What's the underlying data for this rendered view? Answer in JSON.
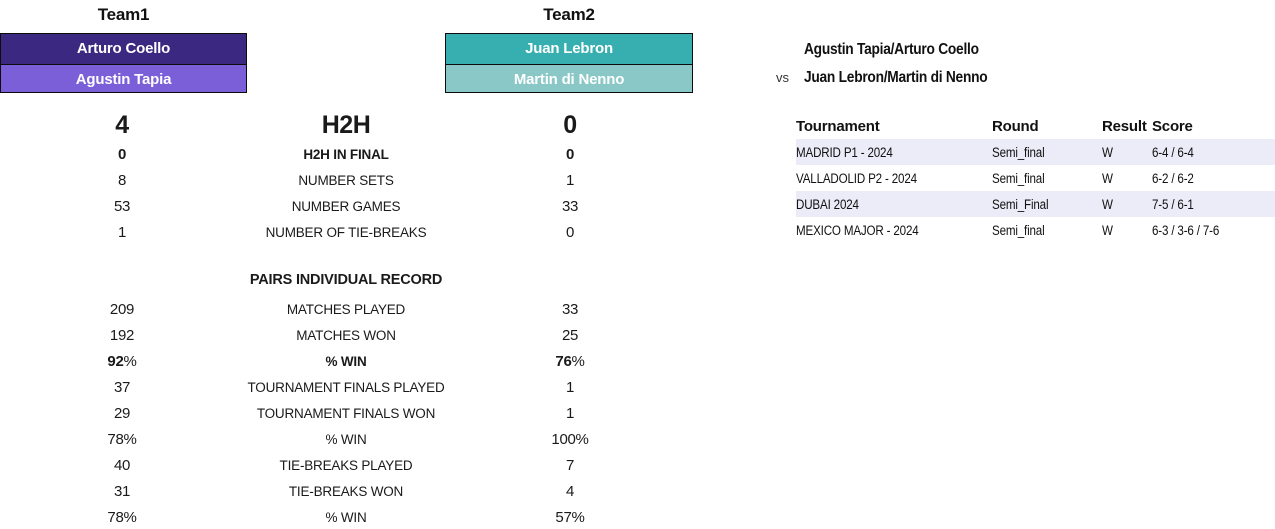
{
  "teams": {
    "team1": {
      "header": "Team1",
      "players": [
        "Arturo Coello",
        "Agustin Tapia"
      ],
      "color_top": "#3b2880",
      "color_bottom": "#7b5fd8"
    },
    "team2": {
      "header": "Team2",
      "players": [
        "Juan Lebron",
        "Martin di Nenno"
      ],
      "color_top": "#37afb0",
      "color_bottom": "#8ac7c7"
    }
  },
  "h2h": {
    "title": "H2H",
    "team1_total": "4",
    "team2_total": "0",
    "rows": [
      {
        "label": "H2H IN FINAL",
        "left": "0",
        "right": "0",
        "bold": true
      },
      {
        "label": "NUMBER SETS",
        "left": "8",
        "right": "1",
        "bold": false
      },
      {
        "label": "NUMBER GAMES",
        "left": "53",
        "right": "33",
        "bold": false
      },
      {
        "label": "NUMBER OF TIE-BREAKS",
        "left": "1",
        "right": "0",
        "bold": false
      }
    ]
  },
  "pairs_record": {
    "title": "PAIRS INDIVIDUAL RECORD",
    "rows": [
      {
        "label": "MATCHES PLAYED",
        "left": "209",
        "right": "33",
        "bold": false,
        "percent": false
      },
      {
        "label": "MATCHES WON",
        "left": "192",
        "right": "25",
        "bold": false,
        "percent": false
      },
      {
        "label": "% WIN",
        "left": "92",
        "right": "76",
        "bold": true,
        "percent": true
      },
      {
        "label": "TOURNAMENT FINALS PLAYED",
        "left": "37",
        "right": "1",
        "bold": false,
        "percent": false
      },
      {
        "label": "TOURNAMENT FINALS WON",
        "left": "29",
        "right": "1",
        "bold": false,
        "percent": false
      },
      {
        "label": "% WIN",
        "left": "78",
        "right": "100",
        "bold": false,
        "percent": true
      },
      {
        "label": "TIE-BREAKS PLAYED",
        "left": "40",
        "right": "7",
        "bold": false,
        "percent": false
      },
      {
        "label": "TIE-BREAKS WON",
        "left": "31",
        "right": "4",
        "bold": false,
        "percent": false
      },
      {
        "label": "% WIN",
        "left": "78",
        "right": "57",
        "bold": false,
        "percent": true
      }
    ]
  },
  "matchup": {
    "vs": "vs",
    "team1_names": "Agustin Tapia/Arturo Coello",
    "team2_names": "Juan Lebron/Martin di Nenno"
  },
  "results": {
    "columns": [
      "Tournament",
      "Round",
      "Result",
      "Score"
    ],
    "rows": [
      {
        "tournament": "MADRID P1 - 2024",
        "round": "Semi_final",
        "result": "W",
        "score": "6-4 / 6-4"
      },
      {
        "tournament": "VALLADOLID P2 - 2024",
        "round": "Semi_final",
        "result": "W",
        "score": "6-2 / 6-2"
      },
      {
        "tournament": "DUBAI 2024",
        "round": "Semi_Final",
        "result": "W",
        "score": "7-5 / 6-1"
      },
      {
        "tournament": "MEXICO MAJOR - 2024",
        "round": "Semi_final",
        "result": "W",
        "score": "6-3 / 3-6 / 7-6"
      }
    ],
    "alt_row_color": "#ebecf7"
  }
}
